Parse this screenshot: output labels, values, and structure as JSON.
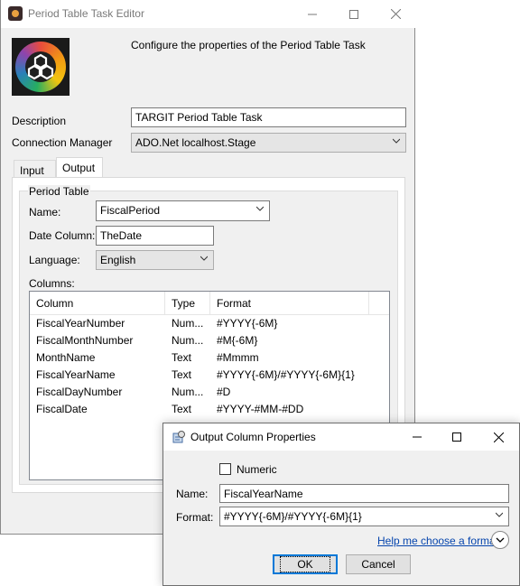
{
  "window": {
    "title": "Period Table Task Editor",
    "header_desc": "Configure the properties of the Period Table Task"
  },
  "form": {
    "description_label": "Description",
    "description_value": "TARGIT Period Table Task",
    "connection_label": "Connection Manager",
    "connection_value": "ADO.Net localhost.Stage"
  },
  "tabs": [
    {
      "label": "Input",
      "selected": false
    },
    {
      "label": "Output",
      "selected": true
    }
  ],
  "output": {
    "group_label": "Period Table",
    "name_label": "Name:",
    "name_value": "FiscalPeriod",
    "date_column_label": "Date Column:",
    "date_column_value": "TheDate",
    "language_label": "Language:",
    "language_value": "English",
    "columns_label": "Columns:",
    "headers": [
      "Column",
      "Type",
      "Format"
    ],
    "rows": [
      [
        "FiscalYearNumber",
        "Num...",
        "#YYYY{-6M}"
      ],
      [
        "FiscalMonthNumber",
        "Num...",
        "#M{-6M}"
      ],
      [
        "MonthName",
        "Text",
        "#Mmmm"
      ],
      [
        "FiscalYearName",
        "Text",
        "#YYYY{-6M}/#YYYY{-6M}{1}"
      ],
      [
        "FiscalDayNumber",
        "Num...",
        "#D"
      ],
      [
        "FiscalDate",
        "Text",
        "#YYYY-#MM-#DD"
      ]
    ]
  },
  "dialog": {
    "title": "Output Column Properties",
    "numeric_label": "Numeric",
    "numeric_checked": false,
    "name_label": "Name:",
    "name_value": "FiscalYearName",
    "format_label": "Format:",
    "format_value": "#YYYY{-6M}/#YYYY{-6M}{1}",
    "help_link": "Help me choose a format",
    "ok_label": "OK",
    "cancel_label": "Cancel"
  },
  "icons": {
    "app": "targit-logo-icon",
    "dialog": "properties-icon"
  }
}
